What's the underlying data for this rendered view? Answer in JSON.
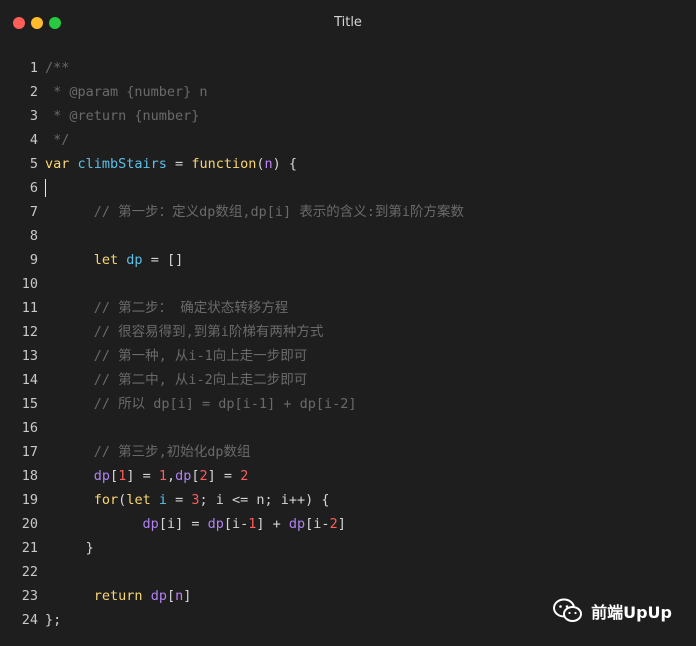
{
  "window": {
    "title": "Title"
  },
  "colors": {
    "background": "#1e1e1e",
    "comment": "#6a6a6a",
    "keyword": "#f7d774",
    "identifier": "#5fbfe6",
    "variable": "#b083f0",
    "number": "#ff5c5c"
  },
  "code": {
    "lines": [
      {
        "n": "1",
        "tokens": [
          {
            "c": "t-comment",
            "t": "/**"
          }
        ]
      },
      {
        "n": "2",
        "tokens": [
          {
            "c": "t-comment",
            "t": " * @param {number} n"
          }
        ]
      },
      {
        "n": "3",
        "tokens": [
          {
            "c": "t-comment",
            "t": " * @return {number}"
          }
        ]
      },
      {
        "n": "4",
        "tokens": [
          {
            "c": "t-comment",
            "t": " */"
          }
        ]
      },
      {
        "n": "5",
        "tokens": [
          {
            "c": "t-kw",
            "t": "var "
          },
          {
            "c": "t-var",
            "t": "climbStairs"
          },
          {
            "c": "t-plain",
            "t": " = "
          },
          {
            "c": "t-kw",
            "t": "function"
          },
          {
            "c": "t-plain",
            "t": "("
          },
          {
            "c": "t-param",
            "t": "n"
          },
          {
            "c": "t-plain",
            "t": ") {"
          }
        ]
      },
      {
        "n": "6",
        "tokens": [],
        "cursor": true
      },
      {
        "n": "7",
        "tokens": [
          {
            "c": "t-comment",
            "t": "      // 第一步：定义dp数组,dp[i] 表示的含义:到第i阶方案数"
          }
        ]
      },
      {
        "n": "8",
        "tokens": []
      },
      {
        "n": "9",
        "tokens": [
          {
            "c": "t-plain",
            "t": "      "
          },
          {
            "c": "t-kw",
            "t": "let "
          },
          {
            "c": "t-var",
            "t": "dp"
          },
          {
            "c": "t-plain",
            "t": " = []"
          }
        ]
      },
      {
        "n": "10",
        "tokens": []
      },
      {
        "n": "11",
        "tokens": [
          {
            "c": "t-comment",
            "t": "      // 第二步： 确定状态转移方程"
          }
        ]
      },
      {
        "n": "12",
        "tokens": [
          {
            "c": "t-comment",
            "t": "      // 很容易得到,到第i阶梯有两种方式"
          }
        ]
      },
      {
        "n": "13",
        "tokens": [
          {
            "c": "t-comment",
            "t": "      // 第一种, 从i-1向上走一步即可"
          }
        ]
      },
      {
        "n": "14",
        "tokens": [
          {
            "c": "t-comment",
            "t": "      // 第二中, 从i-2向上走二步即可"
          }
        ]
      },
      {
        "n": "15",
        "tokens": [
          {
            "c": "t-comment",
            "t": "      // 所以 dp[i] = dp[i-1] + dp[i-2]"
          }
        ]
      },
      {
        "n": "16",
        "tokens": []
      },
      {
        "n": "17",
        "tokens": [
          {
            "c": "t-comment",
            "t": "      // 第三步,初始化dp数组"
          }
        ]
      },
      {
        "n": "18",
        "tokens": [
          {
            "c": "t-plain",
            "t": "      "
          },
          {
            "c": "t-dp",
            "t": "dp"
          },
          {
            "c": "t-plain",
            "t": "["
          },
          {
            "c": "t-num",
            "t": "1"
          },
          {
            "c": "t-plain",
            "t": "] = "
          },
          {
            "c": "t-num",
            "t": "1"
          },
          {
            "c": "t-plain",
            "t": ","
          },
          {
            "c": "t-dp",
            "t": "dp"
          },
          {
            "c": "t-plain",
            "t": "["
          },
          {
            "c": "t-num",
            "t": "2"
          },
          {
            "c": "t-plain",
            "t": "] = "
          },
          {
            "c": "t-num",
            "t": "2"
          }
        ]
      },
      {
        "n": "19",
        "tokens": [
          {
            "c": "t-plain",
            "t": "      "
          },
          {
            "c": "t-kw",
            "t": "for"
          },
          {
            "c": "t-plain",
            "t": "("
          },
          {
            "c": "t-kw",
            "t": "let "
          },
          {
            "c": "t-var",
            "t": "i"
          },
          {
            "c": "t-plain",
            "t": " = "
          },
          {
            "c": "t-num",
            "t": "3"
          },
          {
            "c": "t-plain",
            "t": "; i <= n; i++) {"
          }
        ]
      },
      {
        "n": "20",
        "tokens": [
          {
            "c": "t-plain",
            "t": "            "
          },
          {
            "c": "t-dp",
            "t": "dp"
          },
          {
            "c": "t-plain",
            "t": "[i] = "
          },
          {
            "c": "t-dp",
            "t": "dp"
          },
          {
            "c": "t-plain",
            "t": "[i-"
          },
          {
            "c": "t-num",
            "t": "1"
          },
          {
            "c": "t-plain",
            "t": "] + "
          },
          {
            "c": "t-dp",
            "t": "dp"
          },
          {
            "c": "t-plain",
            "t": "[i-"
          },
          {
            "c": "t-num",
            "t": "2"
          },
          {
            "c": "t-plain",
            "t": "]"
          }
        ]
      },
      {
        "n": "21",
        "tokens": [
          {
            "c": "t-plain",
            "t": "     }"
          }
        ]
      },
      {
        "n": "22",
        "tokens": []
      },
      {
        "n": "23",
        "tokens": [
          {
            "c": "t-plain",
            "t": "      "
          },
          {
            "c": "t-kw",
            "t": "return "
          },
          {
            "c": "t-dp",
            "t": "dp"
          },
          {
            "c": "t-plain",
            "t": "["
          },
          {
            "c": "t-param",
            "t": "n"
          },
          {
            "c": "t-plain",
            "t": "]"
          }
        ]
      },
      {
        "n": "24",
        "tokens": [
          {
            "c": "t-plain",
            "t": "};"
          }
        ]
      }
    ]
  },
  "watermark": {
    "icon": "wechat-icon",
    "text": "前端UpUp"
  }
}
